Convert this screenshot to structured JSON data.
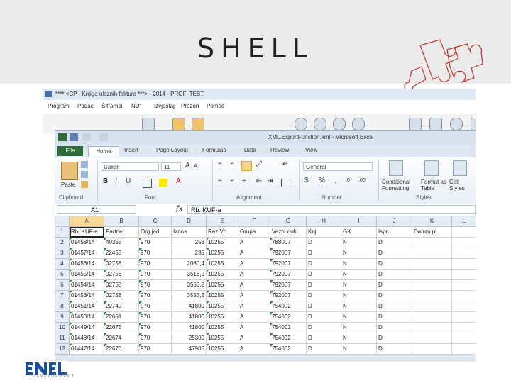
{
  "slide": {
    "title": "SHELL"
  },
  "app": {
    "title": "**** <CP - Knjiga ulaznih faktura ***> - 2014 - PROFI TEST",
    "menu": [
      "Program",
      "Podac",
      "Šifrarnci",
      "NU°",
      "Izvještaj",
      "Prozori",
      "Pomoć"
    ]
  },
  "excel": {
    "title": "XML.ExportFunction.xml - Microsoft Excel",
    "tabs": {
      "file": "File",
      "home": "Home",
      "insert": "Insert",
      "page_layout": "Page Layout",
      "formulas": "Formulas",
      "data": "Data",
      "review": "Review",
      "view": "View"
    },
    "ribbon": {
      "paste": "Paste",
      "font_name": "Calibri",
      "font_size": "11",
      "number_format": "General",
      "groups": {
        "clipboard": "Clipboard",
        "font": "Font",
        "alignment": "Alignment",
        "number": "Number",
        "styles": "Styles"
      },
      "conditional_formatting": "Conditional Formatting",
      "format_as_table": "Format as Table",
      "cell_styles": "Cell Styles"
    },
    "name_box": "A1",
    "fx": "fx",
    "formula": "Rb. KUF-a"
  },
  "columns": [
    "",
    "A",
    "B",
    "C",
    "D",
    "E",
    "F",
    "G",
    "H",
    "I",
    "J",
    "K",
    "L"
  ],
  "rows": [
    [
      "1",
      "Rb. KUF-a",
      "Partner",
      "Org.jed",
      "Iznos",
      "Raz.Vd.",
      "Grupa",
      "Vezni dok",
      "Knj.",
      "GK",
      "Ispr.",
      "Datum pl.",
      ""
    ],
    [
      "2",
      "01458/14",
      "40355",
      "970",
      "258",
      "10255",
      "A",
      "788007",
      "D",
      "N",
      "D",
      "",
      ""
    ],
    [
      "3",
      "01457/14",
      "22455",
      "970",
      "235",
      "10255",
      "A",
      "792007",
      "D",
      "N",
      "D",
      "",
      ""
    ],
    [
      "4",
      "01456/14",
      "02758",
      "970",
      "2080,4",
      "10255",
      "A",
      "792007",
      "D",
      "N",
      "D",
      "",
      ""
    ],
    [
      "5",
      "01455/14",
      "02758",
      "970",
      "3518,9",
      "10255",
      "A",
      "792007",
      "D",
      "N",
      "D",
      "",
      ""
    ],
    [
      "6",
      "01454/14",
      "02758",
      "970",
      "3553,2",
      "10255",
      "A",
      "792007",
      "D",
      "N",
      "D",
      "",
      ""
    ],
    [
      "7",
      "01453/14",
      "02758",
      "970",
      "3553,2",
      "10255",
      "A",
      "792007",
      "D",
      "N",
      "D",
      "",
      ""
    ],
    [
      "8",
      "01451/14",
      "22740",
      "970",
      "41800",
      "10255",
      "A",
      "754002",
      "D",
      "N",
      "D",
      "",
      ""
    ],
    [
      "9",
      "01450/14",
      "22651",
      "970",
      "41800",
      "10255",
      "A",
      "754002",
      "D",
      "N",
      "D",
      "",
      ""
    ],
    [
      "10",
      "01449/14",
      "22675",
      "970",
      "41800",
      "10255",
      "A",
      "754002",
      "D",
      "N",
      "D",
      "",
      ""
    ],
    [
      "11",
      "01448/14",
      "22674",
      "970",
      "25300",
      "10255",
      "A",
      "754002",
      "D",
      "N",
      "D",
      "",
      ""
    ],
    [
      "12",
      "01447/14",
      "22676",
      "970",
      "47905",
      "10255",
      "A",
      "754002",
      "D",
      "N",
      "D",
      "",
      ""
    ]
  ],
  "logo": {
    "text": "ENEL",
    "subtitle": "DEVELOPMENT"
  },
  "colors": {
    "excel_green": "#2c6d37",
    "header_band": "#ebebeb",
    "logo_blue": "#1a4f9c",
    "puzzle_red": "#c0392b"
  }
}
